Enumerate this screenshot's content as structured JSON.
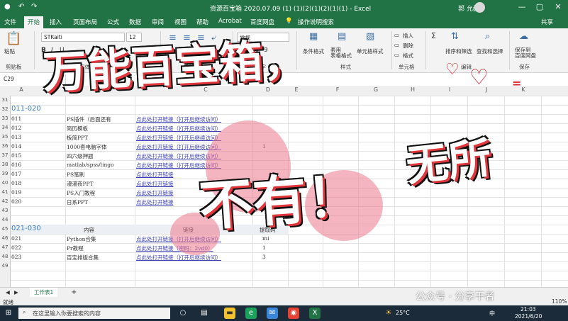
{
  "titlebar": {
    "title": "资源百宝箱 2020.07.09 (1) (1)(2)(1)(2)(1)(1) - Excel",
    "user": "郭 允赫",
    "undo": "↶",
    "redo": "↷",
    "minimize": "—",
    "restore": "▢",
    "close": "✕"
  },
  "menu": {
    "tabs": [
      "文件",
      "开始",
      "插入",
      "页面布局",
      "公式",
      "数据",
      "审阅",
      "视图",
      "帮助",
      "Acrobat",
      "百度网盘",
      "操作说明搜索"
    ],
    "active": "开始",
    "share": "共享"
  },
  "ribbon": {
    "paste": "粘贴",
    "clipboard": "剪贴板",
    "font_name": "STKaiti",
    "font_size": "12",
    "number_format": "常规",
    "font_group": "字体",
    "align_group": "对齐方式",
    "number_group": "数字",
    "percent": "%",
    "comma": "9",
    "cond_format": "条件格式",
    "table_format": "套用\n表格格式",
    "cell_style": "单元格样式",
    "styles_group": "样式",
    "insert": "插入",
    "delete": "删除",
    "format": "格式",
    "cells_group": "单元格",
    "sort": "排序和筛选",
    "find": "查找和选择",
    "edit_group": "编辑",
    "save_baidu": "保存到\n百度网盘",
    "save_group": "保存"
  },
  "formula": {
    "name_box": "C29",
    "fx": "fx"
  },
  "columns": [
    "A",
    "B",
    "C",
    "D",
    "E",
    "F",
    "G",
    "H",
    "I",
    "J",
    "K"
  ],
  "row_numbers": [
    "31",
    "32",
    "33",
    "34",
    "35",
    "36",
    "37",
    "38",
    "39",
    "40",
    "41",
    "42",
    "43",
    "44",
    "45",
    "46",
    "47",
    "48",
    "49"
  ],
  "section1": "011-020",
  "section2": "021-030",
  "section2_headers": {
    "content": "内容",
    "link": "链接",
    "extract": "提取码"
  },
  "rows1": [
    {
      "id": "011",
      "name": "PS插件（后面还有",
      "link": "点此处打开链接（打开后继续访问）",
      "code": ""
    },
    {
      "id": "012",
      "name": "简历模板",
      "link": "点此处打开链接（打开后继续访问）",
      "code": ""
    },
    {
      "id": "013",
      "name": "板简PPT",
      "link": "点此处打开链接（打开后继续访问）",
      "code": ""
    },
    {
      "id": "014",
      "name": "1000套电脑字体",
      "link": "点此处打开链接（打开后继续访问）",
      "code": "1"
    },
    {
      "id": "015",
      "name": "四六级押题",
      "link": "点此处打开链接（打开后继续访问）",
      "code": ""
    },
    {
      "id": "016",
      "name": "matlab/spss/lingo",
      "link": "点此处打开链接（打开后继续访问）",
      "code": ""
    },
    {
      "id": "017",
      "name": "PS笔刷",
      "link": "点此处打开链接",
      "code": ""
    },
    {
      "id": "018",
      "name": "漫漫夜PPT",
      "link": "点此处打开链接",
      "code": ""
    },
    {
      "id": "019",
      "name": "PS入门教程",
      "link": "点此处打开链接",
      "code": ""
    },
    {
      "id": "020",
      "name": "日系PPT",
      "link": "点此处打开链接",
      "code": ""
    }
  ],
  "rows2": [
    {
      "id": "021",
      "name": "Python合集",
      "link": "点此处打开链接（打开后继续访问）",
      "code": "mi"
    },
    {
      "id": "022",
      "name": "Pr教程",
      "link": "点此处打开链接（密码：2vd0）",
      "code": "1"
    },
    {
      "id": "023",
      "name": "百宝排版合集",
      "link": "点此处打开链接（打开后继续访问）",
      "code": "3"
    }
  ],
  "sheet": {
    "tab": "工作表1",
    "add": "+"
  },
  "status": {
    "ready": "就绪",
    "zoom": "110%"
  },
  "taskbar": {
    "search_placeholder": "在这里输入你要搜索的内容",
    "weather": "25°C",
    "ime": "中",
    "time": "21:03",
    "date": "2021/6/20"
  },
  "overlay": {
    "line1": "万能百宝箱，",
    "line1b": "无所",
    "line2": "不有！",
    "watermark": "公众号 · 分享干者"
  }
}
